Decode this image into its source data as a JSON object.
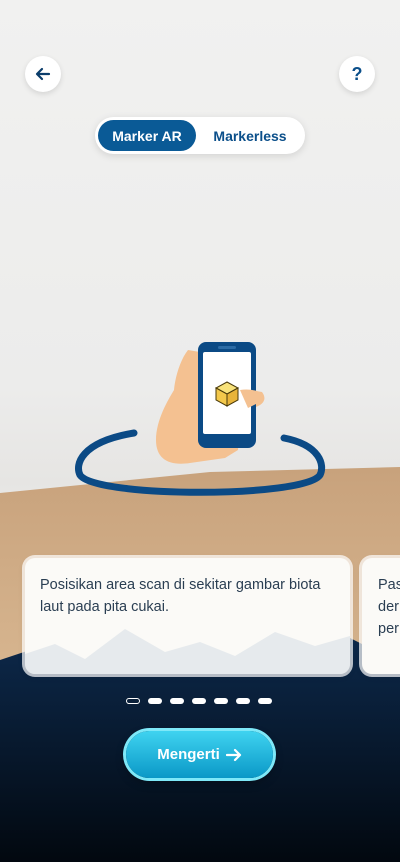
{
  "header": {
    "back_icon": "arrow-left-icon",
    "help_label": "?"
  },
  "mode_toggle": {
    "options": [
      "Marker AR",
      "Markerless"
    ],
    "selected": "Marker AR"
  },
  "illustration": {
    "description_icon": "phone-scan-icon"
  },
  "cards": [
    {
      "text": "Posisikan area scan di sekitar gambar biota laut pada pita cukai."
    },
    {
      "text": "Pas\nder\nper"
    }
  ],
  "pagination": {
    "total": 7,
    "current": 1
  },
  "cta": {
    "label": "Mengerti",
    "icon": "arrow-right-icon"
  }
}
